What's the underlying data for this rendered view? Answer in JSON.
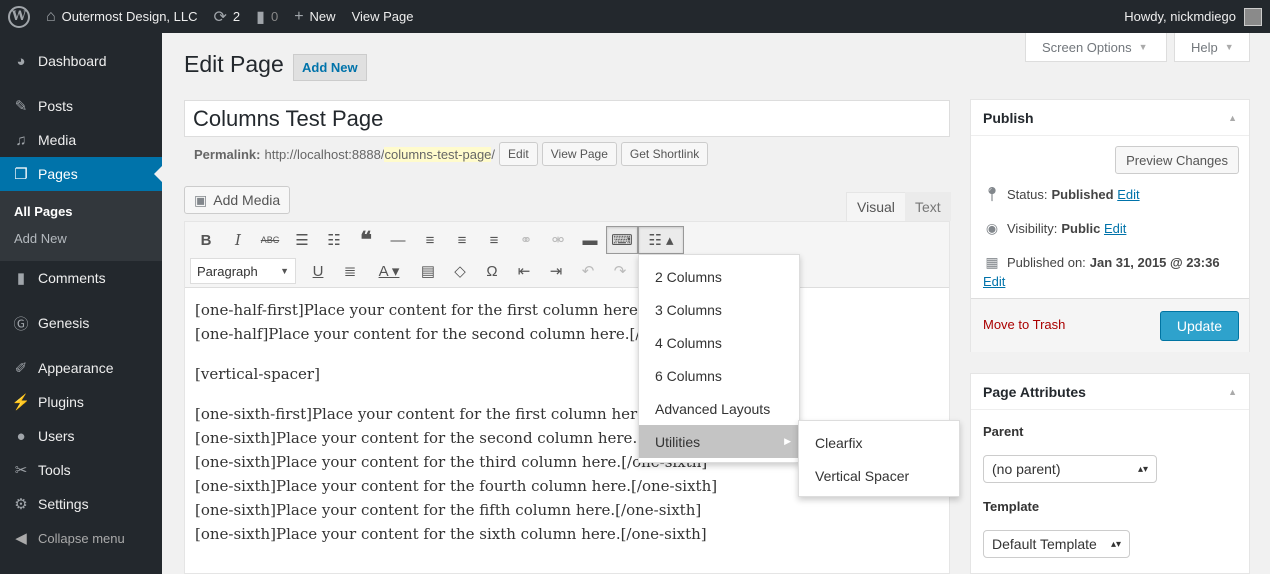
{
  "adminbar": {
    "site_name": "Outermost Design, LLC",
    "updates_count": "2",
    "comments_count": "0",
    "new_label": "New",
    "view_page_label": "View Page",
    "howdy": "Howdy, nickmdiego"
  },
  "sidebar": {
    "items": [
      {
        "label": "Dashboard",
        "icon": "dashboard-icon"
      },
      {
        "label": "Posts",
        "icon": "pin-icon"
      },
      {
        "label": "Media",
        "icon": "media-icon"
      },
      {
        "label": "Pages",
        "icon": "pages-icon"
      },
      {
        "label": "Comments",
        "icon": "comments-icon"
      },
      {
        "label": "Genesis",
        "icon": "genesis-icon"
      },
      {
        "label": "Appearance",
        "icon": "brush-icon"
      },
      {
        "label": "Plugins",
        "icon": "plugin-icon"
      },
      {
        "label": "Users",
        "icon": "users-icon"
      },
      {
        "label": "Tools",
        "icon": "wrench-icon"
      },
      {
        "label": "Settings",
        "icon": "settings-icon"
      }
    ],
    "submenu": [
      "All Pages",
      "Add New"
    ],
    "collapse_label": "Collapse menu"
  },
  "screen_options": {
    "screen_label": "Screen Options",
    "help_label": "Help"
  },
  "page": {
    "title": "Edit Page",
    "add_new": "Add New",
    "post_title": "Columns Test Page",
    "permalink_label": "Permalink:",
    "permalink_base": "http://localhost:8888/",
    "permalink_slug": "columns-test-page",
    "permalink_trail": "/",
    "edit_btn": "Edit",
    "view_btn": "View Page",
    "shortlink_btn": "Get Shortlink"
  },
  "editor": {
    "add_media": "Add Media",
    "tab_visual": "Visual",
    "tab_text": "Text",
    "format_select": "Paragraph",
    "content": [
      "[one-half-first]Place your content for the first column here.[/one-half-first]",
      "[one-half]Place your content for the second column here.[/one-half]",
      "[vertical-spacer]",
      "[one-sixth-first]Place your content for the first column here.[/one-sixth-first]",
      "[one-sixth]Place your content for the second column here.[/one-sixth]",
      "[one-sixth]Place your content for the third column here.[/one-sixth]",
      "[one-sixth]Place your content for the fourth column here.[/one-sixth]",
      "[one-sixth]Place your content for the fifth column here.[/one-sixth]",
      "[one-sixth]Place your content for the sixth column here.[/one-sixth]"
    ]
  },
  "dropdown": {
    "items": [
      "2 Columns",
      "3 Columns",
      "4 Columns",
      "6 Columns",
      "Advanced Layouts",
      "Utilities"
    ],
    "utilities_items": [
      "Clearfix",
      "Vertical Spacer"
    ]
  },
  "publish": {
    "title": "Publish",
    "preview_btn": "Preview Changes",
    "status_label": "Status:",
    "status_value": "Published",
    "visibility_label": "Visibility:",
    "visibility_value": "Public",
    "published_label": "Published on:",
    "published_value": "Jan 31, 2015 @ 23:36",
    "edit_link": "Edit",
    "trash": "Move to Trash",
    "update_btn": "Update"
  },
  "attributes": {
    "title": "Page Attributes",
    "parent_label": "Parent",
    "parent_value": "(no parent)",
    "template_label": "Template",
    "template_value": "Default Template"
  },
  "colors": {
    "accent": "#0073aa",
    "adminbar": "#23282d",
    "update": "#2ea2cc",
    "trash": "#aa0000"
  }
}
